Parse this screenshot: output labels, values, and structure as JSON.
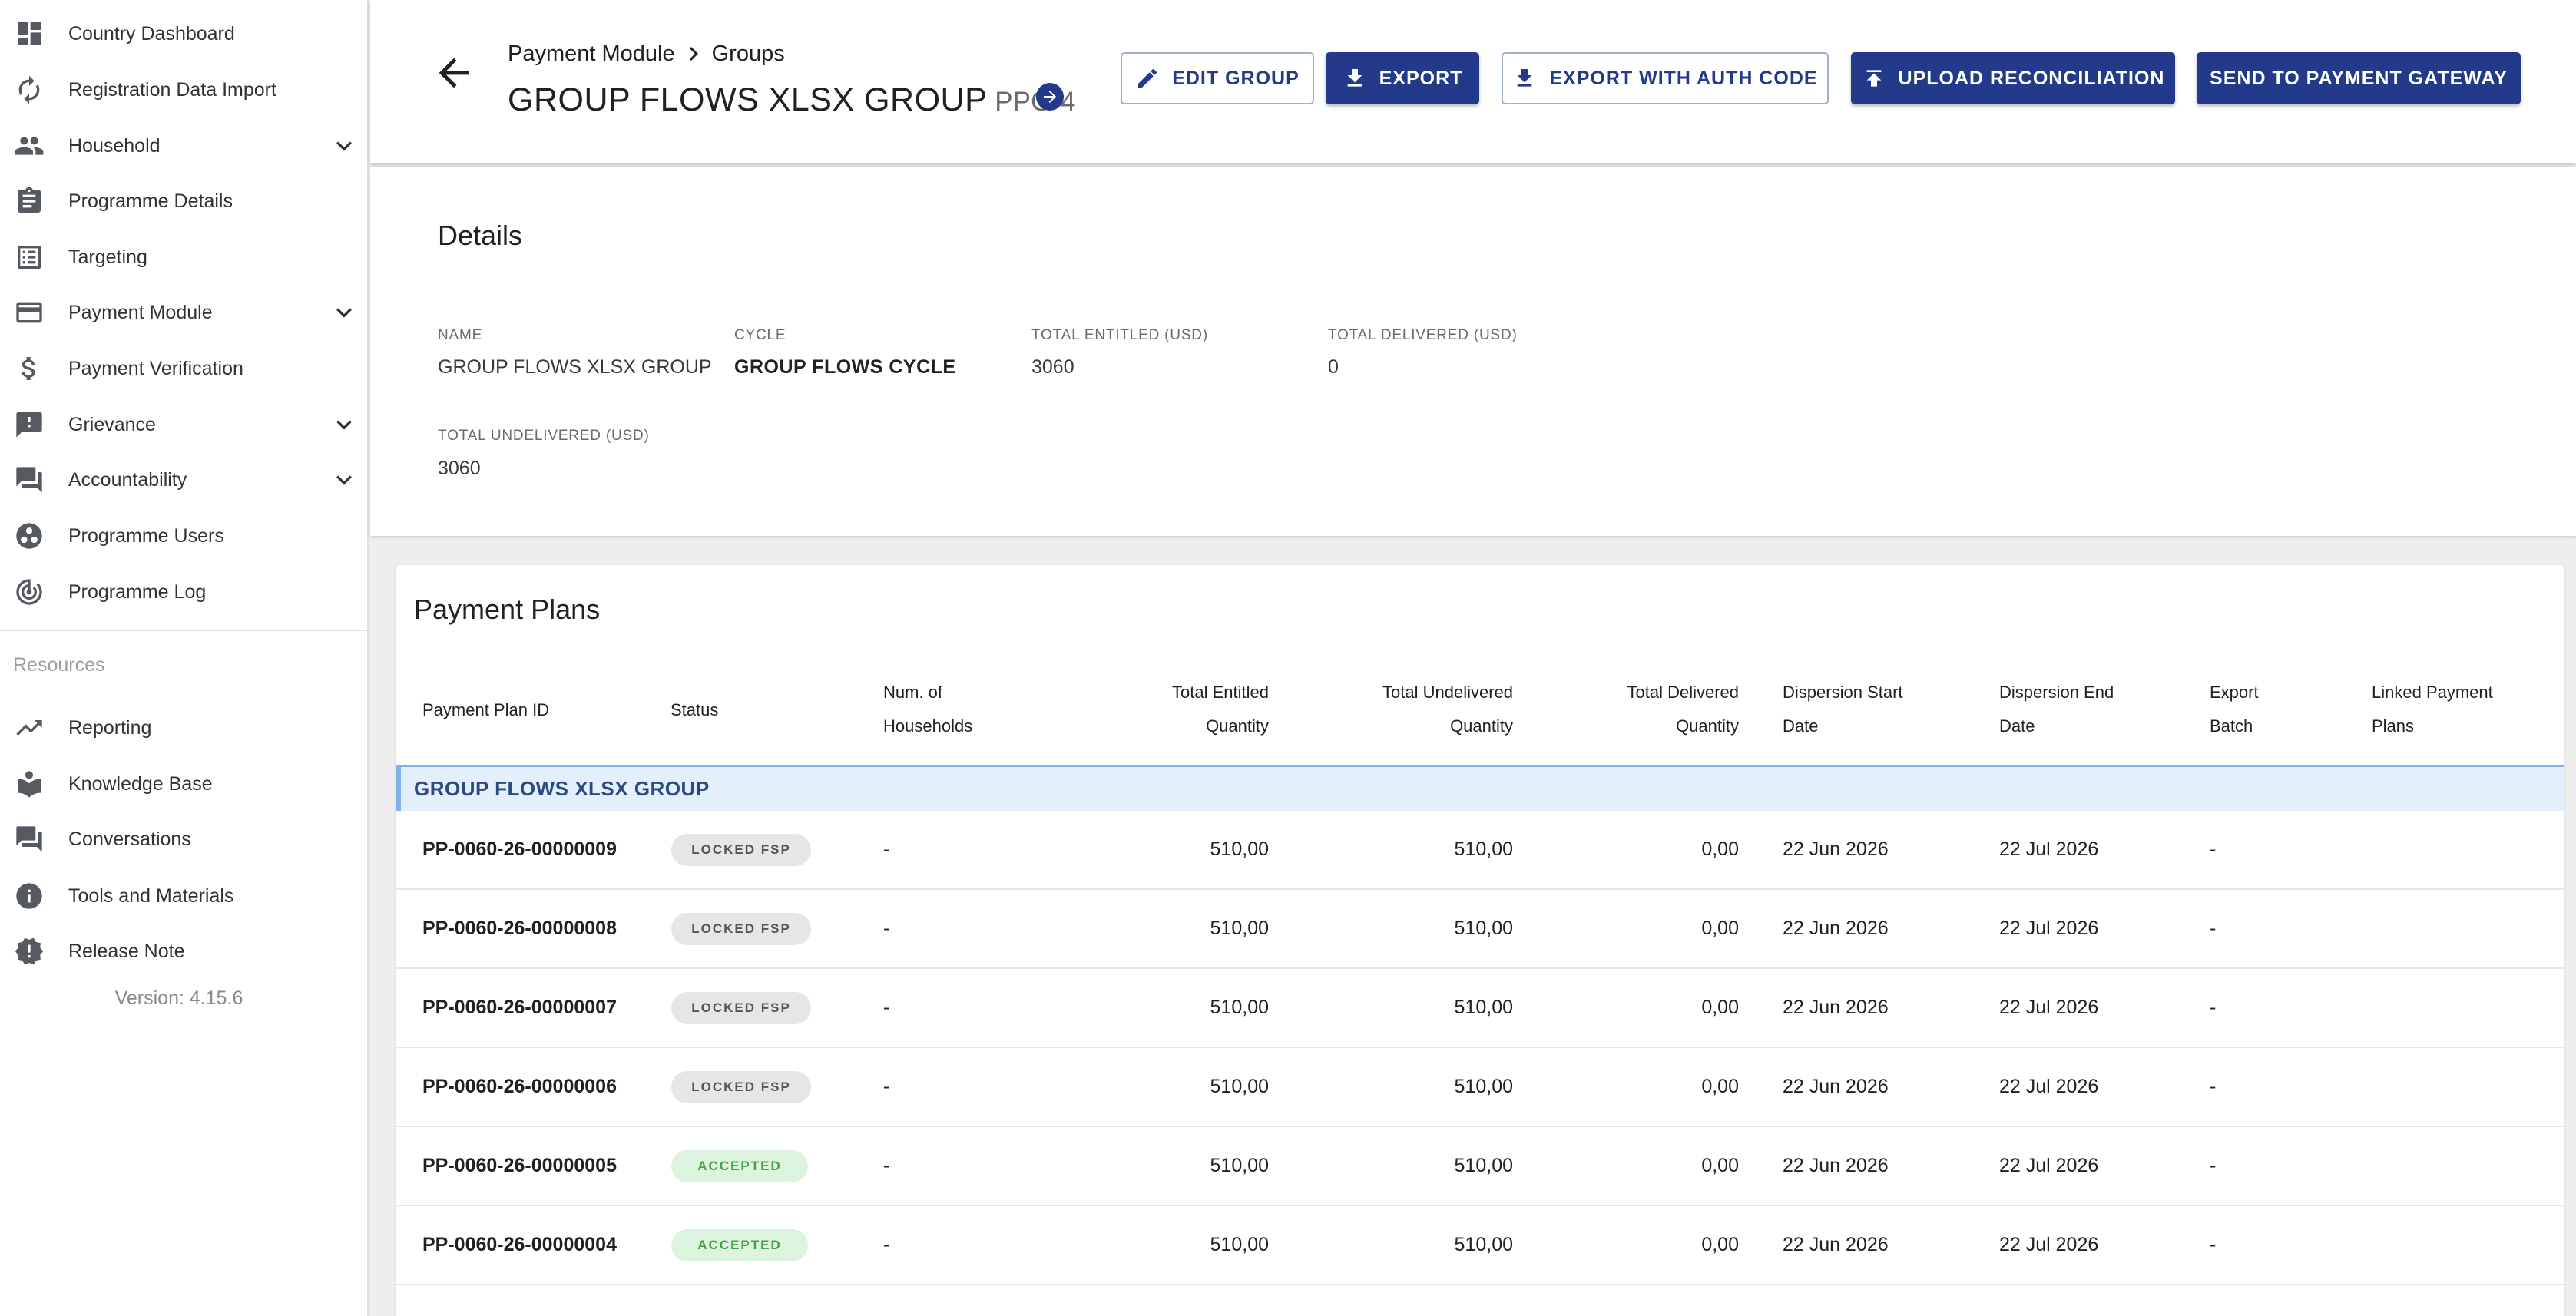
{
  "sidebar": {
    "items": [
      {
        "label": "Country Dashboard",
        "icon": "dashboard-icon"
      },
      {
        "label": "Registration Data Import",
        "icon": "refresh-icon"
      },
      {
        "label": "Household",
        "icon": "people-icon",
        "expandable": true
      },
      {
        "label": "Programme Details",
        "icon": "clipboard-icon"
      },
      {
        "label": "Targeting",
        "icon": "list-icon"
      },
      {
        "label": "Payment Module",
        "icon": "credit-card-icon",
        "expandable": true
      },
      {
        "label": "Payment Verification",
        "icon": "dollar-icon"
      },
      {
        "label": "Grievance",
        "icon": "feedback-icon",
        "expandable": true
      },
      {
        "label": "Accountability",
        "icon": "forum-icon",
        "expandable": true
      },
      {
        "label": "Programme Users",
        "icon": "group-work-icon"
      },
      {
        "label": "Programme Log",
        "icon": "track-changes-icon"
      }
    ],
    "resources_label": "Resources",
    "resources": [
      {
        "label": "Reporting",
        "icon": "trending-up-icon"
      },
      {
        "label": "Knowledge Base",
        "icon": "library-icon"
      },
      {
        "label": "Conversations",
        "icon": "forum-icon"
      },
      {
        "label": "Tools and Materials",
        "icon": "info-icon"
      },
      {
        "label": "Release Note",
        "icon": "new-release-icon"
      }
    ],
    "version": "Version: 4.15.6"
  },
  "header": {
    "breadcrumb": [
      "Payment Module",
      "Groups"
    ],
    "title": "GROUP FLOWS XLSX GROUP",
    "code": "PPG-4",
    "buttons": {
      "edit_group": "EDIT GROUP",
      "export": "EXPORT",
      "export_auth": "EXPORT WITH AUTH CODE",
      "upload_reconciliation": "UPLOAD RECONCILIATION",
      "send_gateway": "SEND TO PAYMENT GATEWAY"
    }
  },
  "details": {
    "title": "Details",
    "name_label": "NAME",
    "name_value": "GROUP FLOWS XLSX GROUP",
    "cycle_label": "CYCLE",
    "cycle_value": "GROUP FLOWS CYCLE",
    "entitled_label": "TOTAL ENTITLED (USD)",
    "entitled_value": "3060",
    "delivered_label": "TOTAL DELIVERED (USD)",
    "delivered_value": "0",
    "undelivered_label": "TOTAL UNDELIVERED (USD)",
    "undelivered_value": "3060"
  },
  "payment_plans": {
    "title": "Payment Plans",
    "columns": {
      "id": "Payment Plan ID",
      "status": "Status",
      "households_1": "Num. of",
      "households_2": "Households",
      "entitled_1": "Total Entitled",
      "entitled_2": "Quantity",
      "undelivered_1": "Total Undelivered",
      "undelivered_2": "Quantity",
      "delivered_1": "Total Delivered",
      "delivered_2": "Quantity",
      "start_1": "Dispersion Start",
      "start_2": "Date",
      "end_1": "Dispersion End",
      "end_2": "Date",
      "batch_1": "Export",
      "batch_2": "Batch",
      "linked_1": "Linked Payment",
      "linked_2": "Plans"
    },
    "group_label": "GROUP FLOWS XLSX GROUP",
    "rows": [
      {
        "id": "PP-0060-26-00000009",
        "status": "LOCKED FSP",
        "households": "-",
        "entitled": "510,00",
        "undelivered": "510,00",
        "delivered": "0,00",
        "start": "22 Jun 2026",
        "end": "22 Jul 2026",
        "batch": "-"
      },
      {
        "id": "PP-0060-26-00000008",
        "status": "LOCKED FSP",
        "households": "-",
        "entitled": "510,00",
        "undelivered": "510,00",
        "delivered": "0,00",
        "start": "22 Jun 2026",
        "end": "22 Jul 2026",
        "batch": "-"
      },
      {
        "id": "PP-0060-26-00000007",
        "status": "LOCKED FSP",
        "households": "-",
        "entitled": "510,00",
        "undelivered": "510,00",
        "delivered": "0,00",
        "start": "22 Jun 2026",
        "end": "22 Jul 2026",
        "batch": "-"
      },
      {
        "id": "PP-0060-26-00000006",
        "status": "LOCKED FSP",
        "households": "-",
        "entitled": "510,00",
        "undelivered": "510,00",
        "delivered": "0,00",
        "start": "22 Jun 2026",
        "end": "22 Jul 2026",
        "batch": "-"
      },
      {
        "id": "PP-0060-26-00000005",
        "status": "ACCEPTED",
        "households": "-",
        "entitled": "510,00",
        "undelivered": "510,00",
        "delivered": "0,00",
        "start": "22 Jun 2026",
        "end": "22 Jul 2026",
        "batch": "-"
      },
      {
        "id": "PP-0060-26-00000004",
        "status": "ACCEPTED",
        "households": "-",
        "entitled": "510,00",
        "undelivered": "510,00",
        "delivered": "0,00",
        "start": "22 Jun 2026",
        "end": "22 Jul 2026",
        "batch": "-"
      }
    ]
  },
  "colors": {
    "primary": "#233a8b",
    "group_row_bg": "#e3f0fc",
    "accepted_bg": "#dcf3dd",
    "accepted_text": "#45a049",
    "locked_bg": "#e6e6e6"
  }
}
